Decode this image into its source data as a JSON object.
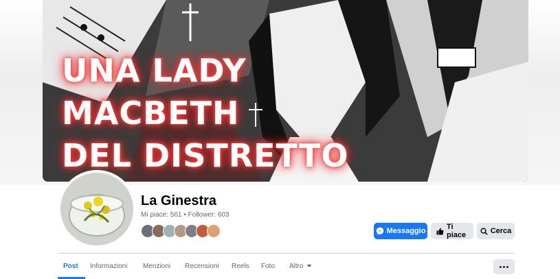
{
  "cover": {
    "title_lines": [
      "UNA LADY",
      "MACBETH",
      "DEL DISTRETTO"
    ]
  },
  "page": {
    "name": "La Ginestra",
    "stats": "Mi piace: 561 • Follower: 603"
  },
  "actions": {
    "message_label": "Messaggio",
    "like_label": "Ti piace",
    "search_label": "Cerca"
  },
  "tabs": [
    {
      "label": "Post",
      "active": true
    },
    {
      "label": "Informazioni"
    },
    {
      "label": "Menzioni"
    },
    {
      "label": "Recensioni"
    },
    {
      "label": "Reels"
    },
    {
      "label": "Foto"
    },
    {
      "label": "Altro"
    }
  ],
  "colors": {
    "accent": "#1877f2",
    "secondary_button": "#e4e6eb",
    "muted_text": "#65676b"
  }
}
